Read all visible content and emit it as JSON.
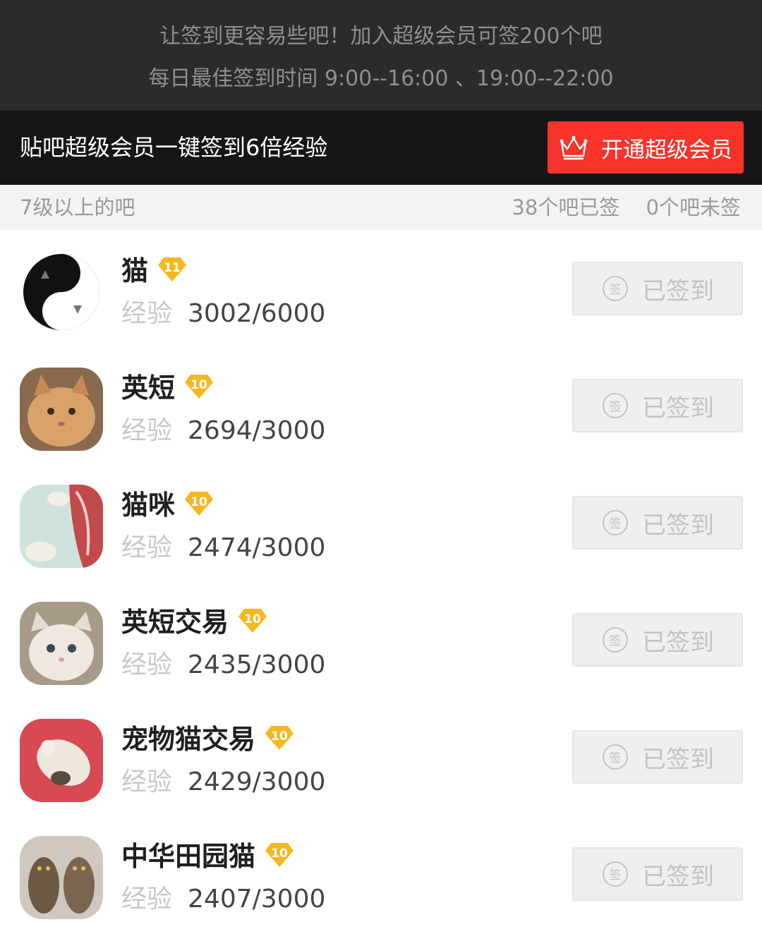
{
  "top_info": {
    "line1": "让签到更容易些吧！加入超级会员可签200个吧",
    "line2": "每日最佳签到时间  9:00--16:00 、19:00--22:00"
  },
  "promo": {
    "text": "贴吧超级会员一键签到6倍经验",
    "button_label": "开通超级会员",
    "button_color": "#f7332a"
  },
  "section": {
    "title": "7级以上的吧",
    "signed_count": "38个吧已签",
    "unsigned_count": "0个吧未签"
  },
  "exp_label": "经验",
  "sign_icon_char": "签",
  "forums": [
    {
      "name": "猫",
      "level": "11",
      "exp": "3002/6000",
      "status": "已签到"
    },
    {
      "name": "英短",
      "level": "10",
      "exp": "2694/3000",
      "status": "已签到"
    },
    {
      "name": "猫咪",
      "level": "10",
      "exp": "2474/3000",
      "status": "已签到"
    },
    {
      "name": "英短交易",
      "level": "10",
      "exp": "2435/3000",
      "status": "已签到"
    },
    {
      "name": "宠物猫交易",
      "level": "10",
      "exp": "2429/3000",
      "status": "已签到"
    },
    {
      "name": "中华田园猫",
      "level": "10",
      "exp": "2407/3000",
      "status": "已签到"
    }
  ]
}
